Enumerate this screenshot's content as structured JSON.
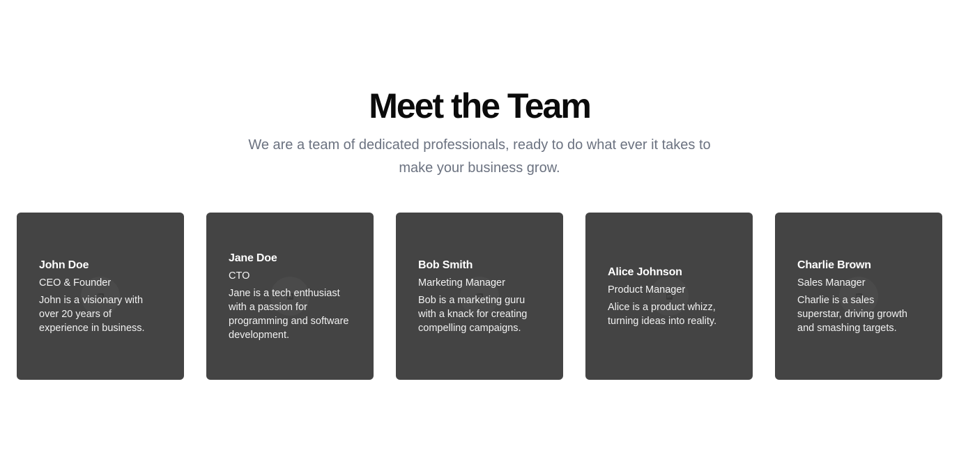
{
  "header": {
    "title": "Meet the Team",
    "subtitle": "We are a team of dedicated professionals, ready to do what ever it takes to make your business grow."
  },
  "team": [
    {
      "name": "John Doe",
      "role": "CEO & Founder",
      "bio": "John is a visionary with over 20 years of experience in business."
    },
    {
      "name": "Jane Doe",
      "role": "CTO",
      "bio": "Jane is a tech enthusiast with a passion for programming and software development."
    },
    {
      "name": "Bob Smith",
      "role": "Marketing Manager",
      "bio": "Bob is a marketing guru with a knack for creating compelling campaigns."
    },
    {
      "name": "Alice Johnson",
      "role": "Product Manager",
      "bio": "Alice is a product whizz, turning ideas into reality."
    },
    {
      "name": "Charlie Brown",
      "role": "Sales Manager",
      "bio": "Charlie is a sales superstar, driving growth and smashing targets."
    }
  ],
  "icons": {
    "social": "linkedin-icon"
  },
  "colors": {
    "card_background": "#444444",
    "title": "#0b0b0b",
    "subtitle": "#6b7280"
  }
}
